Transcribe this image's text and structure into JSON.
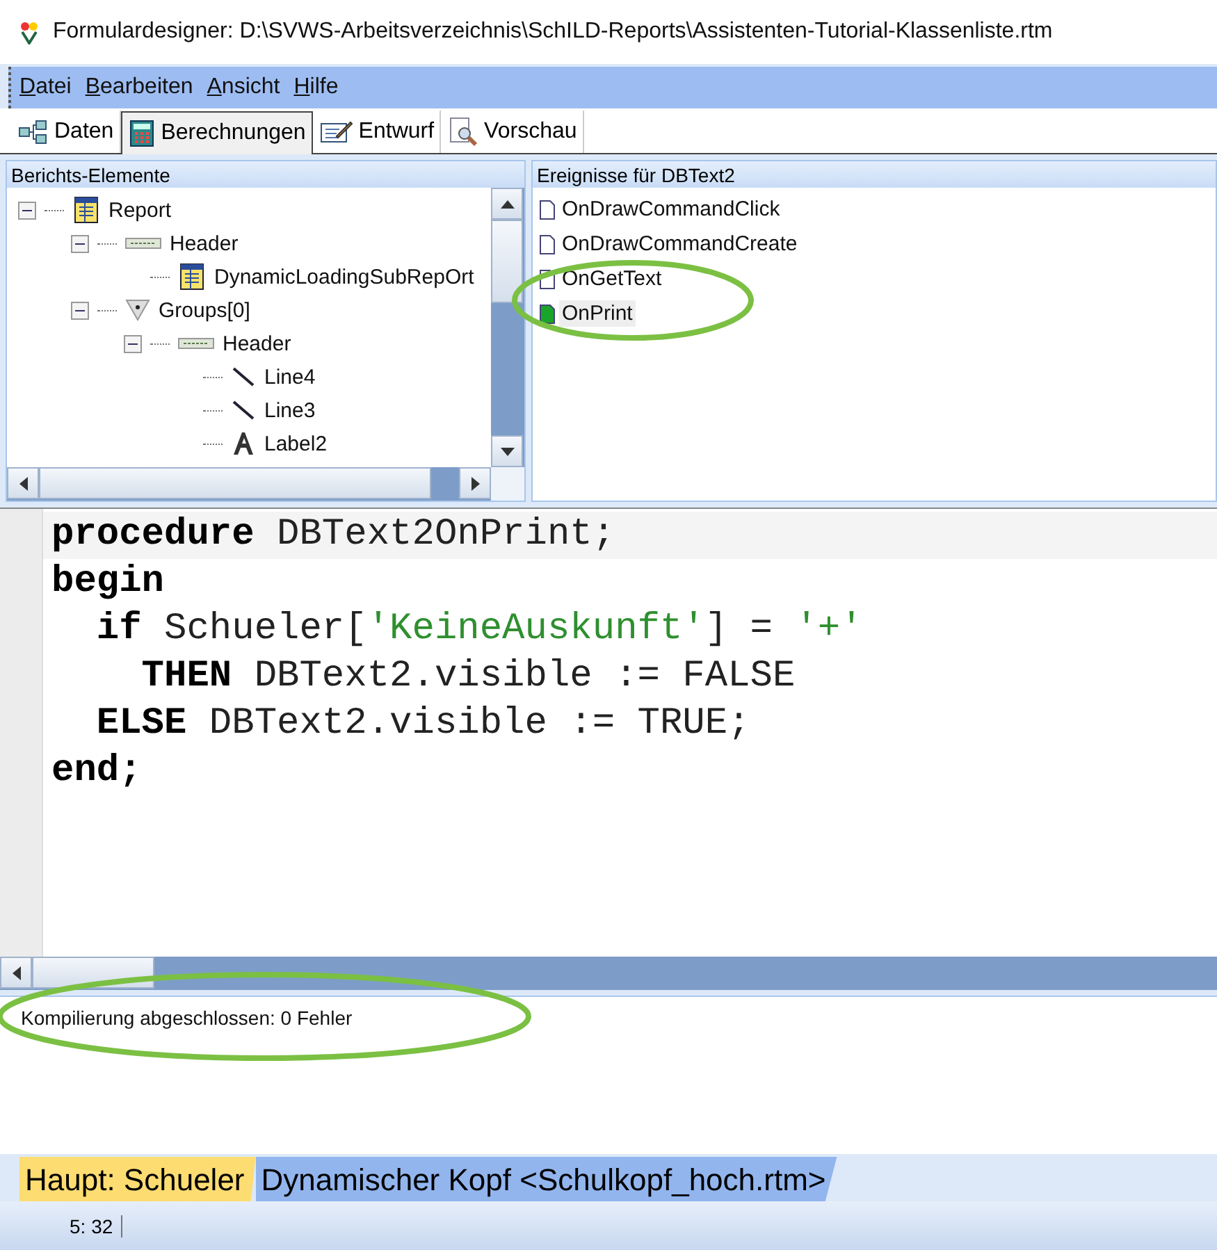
{
  "window": {
    "title": "Formulardesigner: D:\\SVWS-Arbeitsverzeichnis\\SchILD-Reports\\Assistenten-Tutorial-Klassenliste.rtm"
  },
  "menu": [
    {
      "accel": "D",
      "rest": "atei"
    },
    {
      "accel": "B",
      "rest": "earbeiten"
    },
    {
      "accel": "A",
      "rest": "nsicht"
    },
    {
      "accel": "H",
      "rest": "ilfe"
    }
  ],
  "tabs": [
    {
      "label": "Daten",
      "kind": "data",
      "selected": false
    },
    {
      "label": "Berechnungen",
      "kind": "calc",
      "selected": true
    },
    {
      "label": "Entwurf",
      "kind": "design",
      "selected": false
    },
    {
      "label": "Vorschau",
      "kind": "preview",
      "selected": false
    }
  ],
  "tree": {
    "title": "Berichts-Elemente",
    "items": [
      {
        "label": "Report",
        "kind": "report",
        "expanded": true,
        "children": [
          {
            "label": "Header",
            "kind": "band",
            "expanded": true,
            "children": [
              {
                "label": "DynamicLoadingSubRepOrt",
                "kind": "report"
              }
            ]
          },
          {
            "label": "Groups[0]",
            "kind": "group",
            "expanded": true,
            "children": [
              {
                "label": "Header",
                "kind": "band",
                "expanded": true,
                "children": [
                  {
                    "label": "Line4",
                    "kind": "line"
                  },
                  {
                    "label": "Line3",
                    "kind": "line"
                  },
                  {
                    "label": "Label2",
                    "kind": "label"
                  }
                ]
              }
            ]
          }
        ]
      }
    ]
  },
  "events": {
    "title": "Ereignisse für DBText2",
    "items": [
      {
        "label": "OnDrawCommandClick",
        "has_code": false,
        "selected": false
      },
      {
        "label": "OnDrawCommandCreate",
        "has_code": false,
        "selected": false
      },
      {
        "label": "OnGetText",
        "has_code": false,
        "selected": false
      },
      {
        "label": "OnPrint",
        "has_code": true,
        "selected": true
      }
    ]
  },
  "code": [
    [
      {
        "kind": "keyword",
        "text": "procedure"
      },
      {
        "kind": "ident",
        "text": " DBText2OnPrint;"
      }
    ],
    [
      {
        "kind": "keyword",
        "text": "begin"
      }
    ],
    [
      {
        "kind": "keyword",
        "text": "  if"
      },
      {
        "kind": "ident",
        "text": " Schueler["
      },
      {
        "kind": "string",
        "text": "'KeineAuskunft'"
      },
      {
        "kind": "ident",
        "text": "] = "
      },
      {
        "kind": "string",
        "text": "'+'"
      }
    ],
    [
      {
        "kind": "keyword",
        "text": "    THEN"
      },
      {
        "kind": "ident",
        "text": " DBText2.visible := FALSE"
      }
    ],
    [
      {
        "kind": "keyword",
        "text": "  ELSE"
      },
      {
        "kind": "ident",
        "text": " DBText2.visible := TRUE;"
      }
    ],
    [
      {
        "kind": "keyword",
        "text": "end;"
      }
    ]
  ],
  "messages": [
    "Kompilierung abgeschlossen: 0 Fehler"
  ],
  "bottom_tabs": [
    {
      "label": "Haupt: Schueler",
      "selected": true
    },
    {
      "label": "Dynamischer Kopf <Schulkopf_hoch.rtm>",
      "selected": false
    }
  ],
  "status_bar": {
    "position": "5: 32"
  }
}
